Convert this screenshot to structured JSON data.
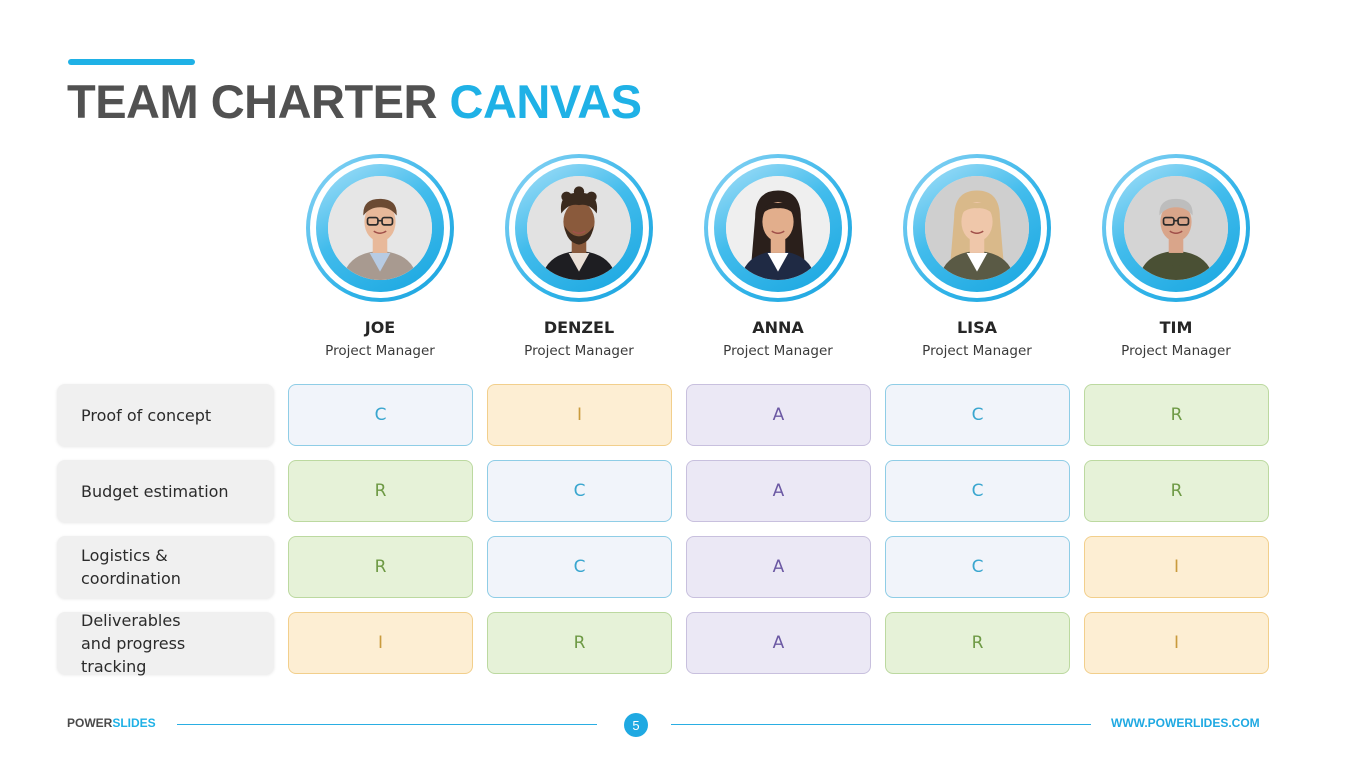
{
  "title": {
    "main": "TEAM CHARTER",
    "highlight": "CANVAS"
  },
  "colors": {
    "accent": "#1fb1e6",
    "title_gray": "#515151",
    "raci": {
      "C": "#3aa6cf",
      "I": "#c99b3d",
      "A": "#6b58a3",
      "R": "#6e9a45"
    }
  },
  "members": [
    {
      "name": "JOE",
      "role": "Project Manager",
      "photo": "headshot-man-glasses-blazer"
    },
    {
      "name": "DENZEL",
      "role": "Project Manager",
      "photo": "headshot-man-curly-hair-beard"
    },
    {
      "name": "ANNA",
      "role": "Project Manager",
      "photo": "headshot-woman-dark-hair"
    },
    {
      "name": "LISA",
      "role": "Project Manager",
      "photo": "headshot-woman-blonde-hair"
    },
    {
      "name": "TIM",
      "role": "Project Manager",
      "photo": "headshot-man-gray-hair-glasses"
    }
  ],
  "tasks": [
    {
      "label": "Proof of concept",
      "assignments": [
        "C",
        "I",
        "A",
        "C",
        "R"
      ]
    },
    {
      "label": "Budget estimation",
      "assignments": [
        "R",
        "C",
        "A",
        "C",
        "R"
      ]
    },
    {
      "label": "Logistics & coordination",
      "assignments": [
        "R",
        "C",
        "A",
        "C",
        "I"
      ]
    },
    {
      "label": "Deliverables and progress tracking",
      "assignments": [
        "I",
        "R",
        "A",
        "R",
        "I"
      ]
    }
  ],
  "footer": {
    "brand_main": "POWER",
    "brand_highlight": "SLIDES",
    "page": "5",
    "url": "WWW.POWERLIDES.COM"
  }
}
